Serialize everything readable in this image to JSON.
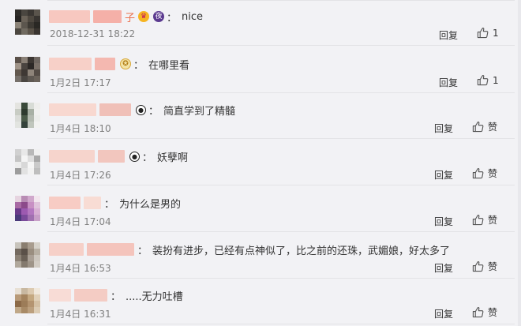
{
  "comments": [
    {
      "name_blur": [
        "#f7c8c0",
        "#f5b0a8"
      ],
      "name_visible": "子",
      "badges": [
        "crown-badge",
        "night-badge"
      ],
      "text": "nice",
      "timestamp": "2018-12-31 18:22",
      "reply": "回复",
      "like_label": "1",
      "avatar_colors": [
        "#2e2c28",
        "#4a4640",
        "#3a3632",
        "#5a544c",
        "#262422",
        "#6a6258",
        "#4e4840",
        "#383430",
        "#8c8478",
        "#5c564e",
        "#3e3a34",
        "#2a2824",
        "#4c4740",
        "#706a60",
        "#5a5248",
        "#3a3530"
      ]
    },
    {
      "name_blur": [
        "#f7d0c8",
        "#f4b8b0"
      ],
      "name_visible": "",
      "badges": [
        "medal-badge"
      ],
      "text": "在哪里看",
      "timestamp": "1月2日 17:17",
      "reply": "回复",
      "like_label": "1",
      "avatar_colors": [
        "#5a5048",
        "#8a8076",
        "#3c3632",
        "#6e6660",
        "#a09488",
        "#4a4440",
        "#2c2826",
        "#7a7068",
        "#62584e",
        "#3e3834",
        "#8e847a",
        "#544c46",
        "#76706a",
        "#4a4642",
        "#5e5852",
        "#6a625a"
      ]
    },
    {
      "name_blur": [
        "#f8d8d0",
        "#f0c0b8"
      ],
      "name_visible": "",
      "badges": [
        "panda-badge"
      ],
      "text": "简直学到了精髓",
      "timestamp": "1月4日 18:10",
      "reply": "回复",
      "like_label": "赞",
      "avatar_colors": [
        "#e4e4e0",
        "#3a4a3a",
        "#d8dcd6",
        "#eeeeec",
        "#c8ccc4",
        "#2e3a2e",
        "#a8b0a4",
        "#f0f0ee",
        "#dadcd8",
        "#4a5a48",
        "#b4bab0",
        "#ecedea",
        "#e2e4e0",
        "#34423a",
        "#c0c6bc",
        "#f2f2f0"
      ]
    },
    {
      "name_blur": [
        "#f6d4cc",
        "#f2c6be"
      ],
      "name_visible": "",
      "badges": [
        "panda-badge"
      ],
      "text": "妖孽啊",
      "timestamp": "1月4日 17:26",
      "reply": "回复",
      "like_label": "赞",
      "avatar_colors": [
        "#d0d0d0",
        "#e8e8e8",
        "#b8b8b8",
        "#f0f0f0",
        "#c4c4c4",
        "#f4f4f4",
        "#dedede",
        "#a8a8a8",
        "#ececec",
        "#d8d8d8",
        "#f6f6f6",
        "#cacaca",
        "#9c9c9c",
        "#e2e2e2",
        "#f2f2f2",
        "#bebebe"
      ]
    },
    {
      "name_blur": [
        "#f7ccc4",
        "#f8dcd4"
      ],
      "name_visible": "",
      "badges": [],
      "text": "为什么是男的",
      "timestamp": "1月4日 17:04",
      "reply": "回复",
      "like_label": "赞",
      "avatar_colors": [
        "#e6d4e0",
        "#b88cb4",
        "#d0a8cc",
        "#f2e6ee",
        "#a86aa4",
        "#8c4a8a",
        "#c890c4",
        "#e0c4dc",
        "#6a3a8a",
        "#9c5ab0",
        "#b478c0",
        "#d8b0d4",
        "#4a3a7a",
        "#7a4a9a",
        "#a070b0",
        "#c8a0c8"
      ]
    },
    {
      "name_blur": [
        "#f6d0c8",
        "#f4c4bc"
      ],
      "name_visible": "",
      "badges": [],
      "text": "装扮有进步，已经有点神似了，比之前的还珠，武媚娘，好太多了",
      "timestamp": "1月4日 16:53",
      "reply": "回复",
      "like_label": "赞",
      "avatar_colors": [
        "#c8c4bc",
        "#8a7e70",
        "#a89c8e",
        "#d6d2ca",
        "#746a60",
        "#5a5048",
        "#9a8e80",
        "#b8b0a4",
        "#8c8276",
        "#6a6056",
        "#aaa096",
        "#ccc6be",
        "#b0a89c",
        "#847a6e",
        "#9e9488",
        "#d2ccc4"
      ]
    },
    {
      "name_blur": [
        "#f8dcd6",
        "#f4ccc4"
      ],
      "name_visible": "",
      "badges": [],
      "text": ".....无力吐槽",
      "timestamp": "1月4日 16:31",
      "reply": "回复",
      "like_label": "赞",
      "avatar_colors": [
        "#e8e0d4",
        "#c8b8a0",
        "#dccab0",
        "#f0e8dc",
        "#b89a78",
        "#a4845e",
        "#c4a880",
        "#e0d0b8",
        "#8c6a48",
        "#9c7c58",
        "#b49470",
        "#d4c0a4",
        "#c0a888",
        "#a88a66",
        "#bca07e",
        "#dcccb4"
      ]
    }
  ]
}
